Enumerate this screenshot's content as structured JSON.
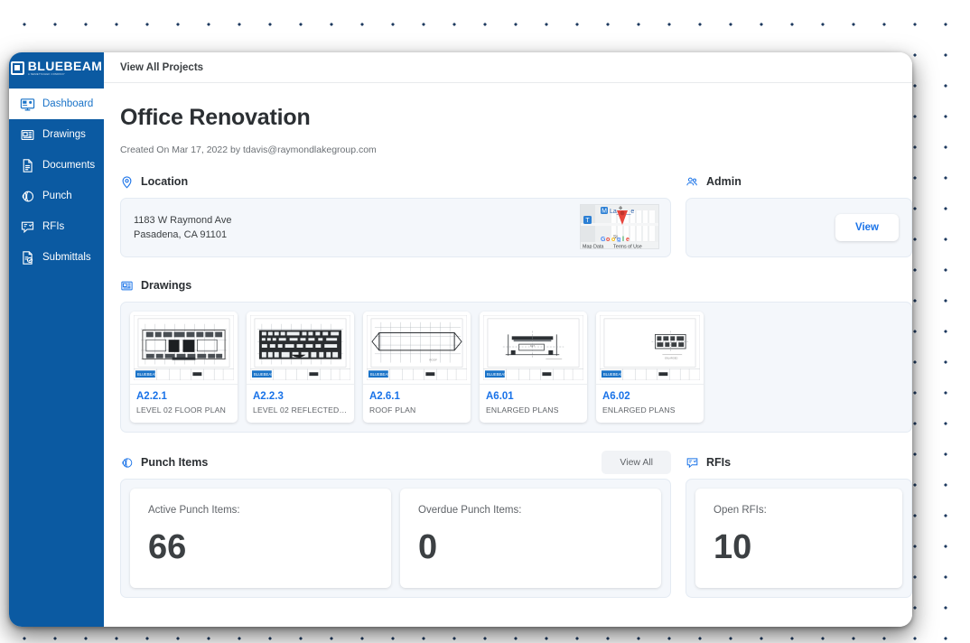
{
  "brand": {
    "name": "BLUEBEAM",
    "tagline": "A NEMETSCHEK COMPANY",
    "accent": "#0b5aa2",
    "link_color": "#1a73e8"
  },
  "header": {
    "breadcrumb": "View All Projects"
  },
  "sidebar": {
    "items": [
      {
        "label": "Dashboard",
        "icon": "dashboard-icon",
        "active": true
      },
      {
        "label": "Drawings",
        "icon": "drawings-icon",
        "active": false
      },
      {
        "label": "Documents",
        "icon": "documents-icon",
        "active": false
      },
      {
        "label": "Punch",
        "icon": "punch-icon",
        "active": false
      },
      {
        "label": "RFIs",
        "icon": "rfis-icon",
        "active": false
      },
      {
        "label": "Submittals",
        "icon": "submittals-icon",
        "active": false
      }
    ]
  },
  "project": {
    "title": "Office Renovation",
    "created": "Created On Mar 17, 2022 by tdavis@raymondlakegroup.com"
  },
  "location": {
    "section_title": "Location",
    "address_line1": "1183 W Raymond Ave",
    "address_line2": "Pasadena, CA 91101",
    "map_data_label": "Map Data",
    "map_terms_label": "Terms of Use",
    "map_brand": "Google"
  },
  "admin": {
    "section_title": "Admin",
    "button_label": "View"
  },
  "drawings": {
    "section_title": "Drawings",
    "items": [
      {
        "number": "A2.2.1",
        "name": "LEVEL 02 FLOOR PLAN",
        "thumb": "floor-plan"
      },
      {
        "number": "A2.2.3",
        "name": "LEVEL 02 REFLECTED CEIL...",
        "thumb": "reflected-ceiling"
      },
      {
        "number": "A2.6.1",
        "name": "ROOF PLAN",
        "thumb": "roof-plan"
      },
      {
        "number": "A6.01",
        "name": "ENLARGED PLANS",
        "thumb": "section"
      },
      {
        "number": "A6.02",
        "name": "ENLARGED PLANS",
        "thumb": "detail"
      }
    ]
  },
  "punch": {
    "section_title": "Punch Items",
    "view_all_label": "View All",
    "cards": [
      {
        "label": "Active Punch Items:",
        "value": "66"
      },
      {
        "label": "Overdue Punch Items:",
        "value": "0"
      }
    ]
  },
  "rfis": {
    "section_title": "RFIs",
    "cards": [
      {
        "label": "Open RFIs:",
        "value": "10"
      }
    ]
  }
}
